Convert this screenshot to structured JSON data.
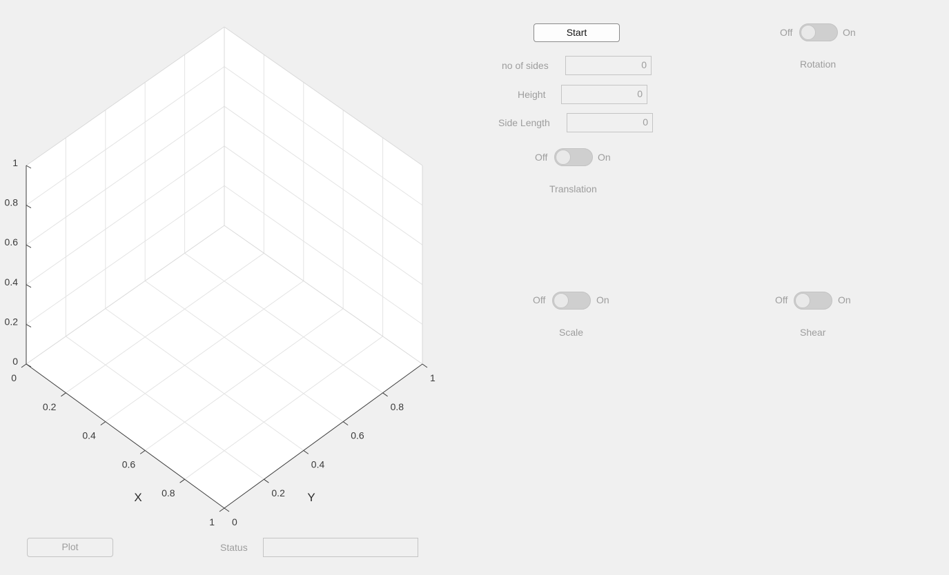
{
  "axes": {
    "z_ticks": [
      "0",
      "0.2",
      "0.4",
      "0.6",
      "0.8",
      "1"
    ],
    "x_ticks": [
      "0",
      "0.2",
      "0.4",
      "0.6",
      "0.8",
      "1"
    ],
    "y_ticks": [
      "0",
      "0.2",
      "0.4",
      "0.6",
      "0.8",
      "1"
    ],
    "x_label": "X",
    "y_label": "Y"
  },
  "controls": {
    "start_label": "Start",
    "no_of_sides": {
      "label": "no of sides",
      "value": "0"
    },
    "height": {
      "label": "Height",
      "value": "0"
    },
    "side_length": {
      "label": "Side Length",
      "value": "0"
    },
    "translation": {
      "off": "Off",
      "on": "On",
      "label": "Translation",
      "state": "Off"
    },
    "rotation": {
      "off": "Off",
      "on": "On",
      "label": "Rotation",
      "state": "Off"
    },
    "scale": {
      "off": "Off",
      "on": "On",
      "label": "Scale",
      "state": "Off"
    },
    "shear": {
      "off": "Off",
      "on": "On",
      "label": "Shear",
      "state": "Off"
    }
  },
  "bottom": {
    "plot_label": "Plot",
    "status_label": "Status",
    "status_value": ""
  }
}
